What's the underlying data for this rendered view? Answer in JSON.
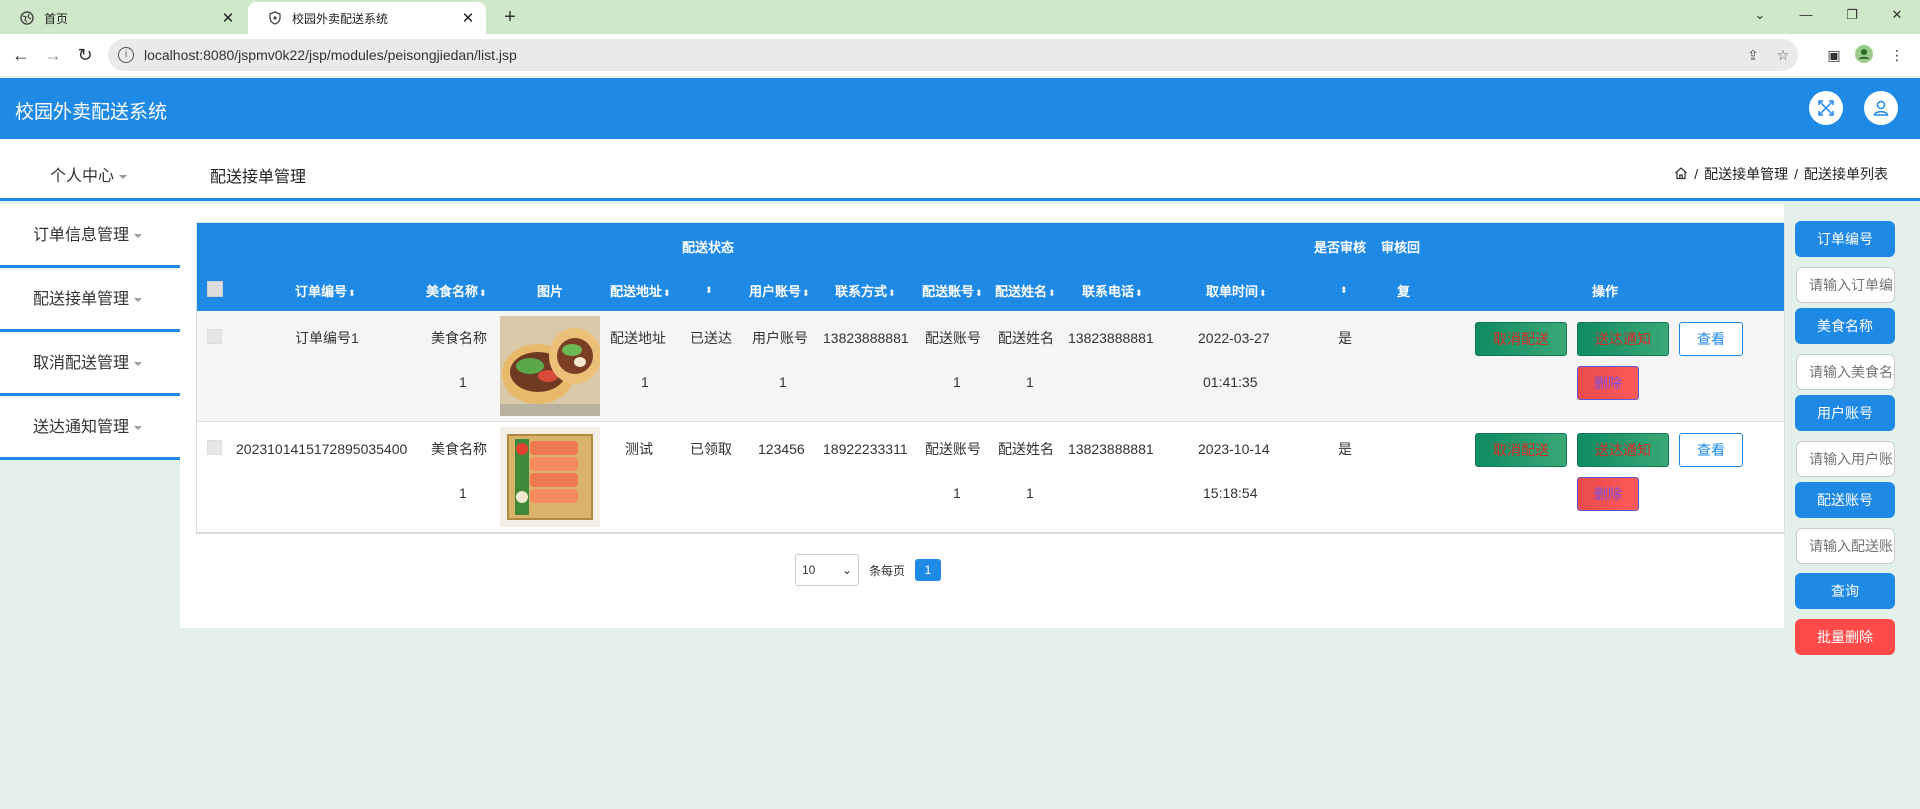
{
  "browser": {
    "tabs": [
      {
        "label": "首页",
        "active": false
      },
      {
        "label": "校园外卖配送系统",
        "active": true
      }
    ],
    "url": "localhost:8080/jspmv0k22/jsp/modules/peisongjiedan/list.jsp"
  },
  "app": {
    "title": "校园外卖配送系统",
    "accent": "#1f8ae6"
  },
  "subbar": {
    "personal_center": "个人中心",
    "page_title": "配送接单管理",
    "breadcrumb": [
      "配送接单管理",
      "配送接单列表"
    ],
    "separator": "/"
  },
  "sidebar": {
    "items": [
      {
        "label": "订单信息管理"
      },
      {
        "label": "配送接单管理"
      },
      {
        "label": "取消配送管理"
      },
      {
        "label": "送达通知管理"
      }
    ]
  },
  "table": {
    "top_headers": {
      "status": "配送状态",
      "audit": "是否审核",
      "audit_reply": "审核回"
    },
    "headers": [
      "订单编号",
      "美食名称",
      "图片",
      "配送地址",
      "用户账号",
      "联系方式",
      "配送账号",
      "配送姓名",
      "联系电话",
      "取单时间",
      "复",
      "操作"
    ],
    "rows": [
      {
        "order_no": "订单编号1",
        "food_name_l1": "美食名称",
        "food_name_l2": "1",
        "address_l1": "配送地址",
        "address_l2": "1",
        "status": "已送达",
        "user_l1": "用户账号",
        "user_l2": "1",
        "contact": "13823888881",
        "courier_l1": "配送账号",
        "courier_l2": "1",
        "courier_name_l1": "配送姓名",
        "courier_name_l2": "1",
        "phone": "13823888881",
        "time_l1": "2022-03-27",
        "time_l2": "01:41:35",
        "audit": "是",
        "image": "tacos"
      },
      {
        "order_no": "20231014151728950354​00",
        "food_name_l1": "美食名称",
        "food_name_l2": "1",
        "address_l1": "测试",
        "address_l2": "",
        "status": "已领取",
        "user_l1": "123456",
        "user_l2": "",
        "contact": "18922233311",
        "courier_l1": "配送账号",
        "courier_l2": "1",
        "courier_name_l1": "配送姓名",
        "courier_name_l2": "1",
        "phone": "13823888881",
        "time_l1": "2023-10-14",
        "time_l2": "15:18:54",
        "audit": "是",
        "image": "sushi"
      }
    ],
    "actions": {
      "cancel": "取消配送",
      "notify": "送达通知",
      "view": "查看",
      "delete": "删除"
    }
  },
  "pagination": {
    "page_size": "10",
    "per_page_label": "条每页",
    "current_page": "1"
  },
  "search": {
    "order_label": "订单编号",
    "order_placeholder": "请输入订单编号",
    "food_label": "美食名称",
    "food_placeholder": "请输入美食名称",
    "user_label": "用户账号",
    "user_placeholder": "请输入用户账号",
    "courier_label": "配送账号",
    "courier_placeholder": "请输入配送账号",
    "query_button": "查询",
    "batch_delete_button": "批量删除"
  }
}
